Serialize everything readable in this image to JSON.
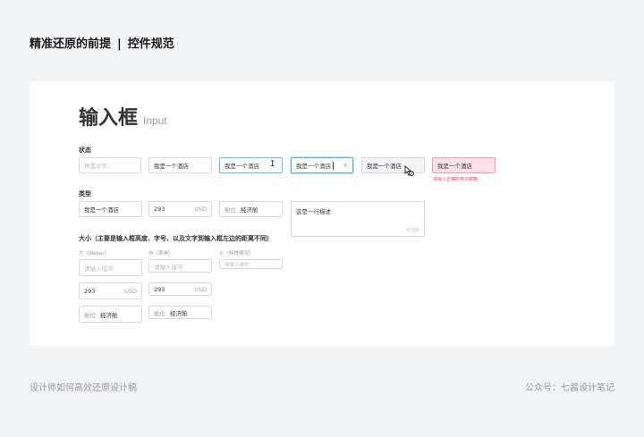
{
  "header": {
    "title": "精准还原的前提",
    "separator": "|",
    "subtitle": "控件规范"
  },
  "card": {
    "title": "输入框",
    "title_en": "Input",
    "states": {
      "label": "状态",
      "default_placeholder": "预置文字...",
      "filled_value": "我是一个酒店",
      "hover_value": "我是一个酒店",
      "focus_value": "我是一个酒店",
      "clear_icon": "×",
      "disabled_value": "我是一个酒店",
      "error_value": "我是一个酒店",
      "error_message": "请输入正确的电子邮箱"
    },
    "types": {
      "label": "类型",
      "text_value": "我是一个酒店",
      "number_value": "293",
      "unit": "USD",
      "prefix_label": "舱位",
      "prefix_value": "经济舱",
      "textarea_value": "这是一行描述",
      "textarea_count": "6/500"
    },
    "sizes": {
      "label": "大小（主要是输入框高度、字号、以及文字到输入框左边的距离不同）",
      "large_label": "大（Webar）",
      "medium_label": "中（表单）",
      "small_label": "小（特殊情况）",
      "placeholder": "请输入城市",
      "number_value": "293",
      "unit": "USD",
      "prefix_label": "舱位",
      "prefix_value": "经济舱"
    }
  },
  "footer": {
    "left": "设计师如何高效还原设计稿",
    "right": "公众号：七酱设计笔记"
  }
}
